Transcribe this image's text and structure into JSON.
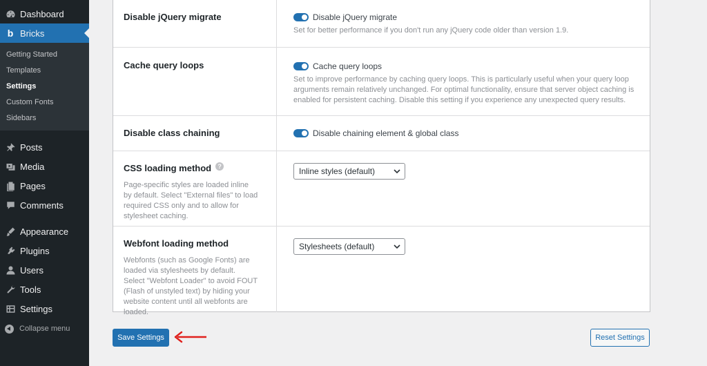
{
  "sidebar": {
    "top_items": [
      {
        "label": "Dashboard",
        "icon": "dashboard-icon"
      },
      {
        "label": "Bricks",
        "icon": "bricks-icon"
      }
    ],
    "submenu": [
      "Getting Started",
      "Templates",
      "Settings",
      "Custom Fonts",
      "Sidebars"
    ],
    "items_group1": [
      {
        "label": "Posts",
        "icon": "pin-icon"
      },
      {
        "label": "Media",
        "icon": "media-icon"
      },
      {
        "label": "Pages",
        "icon": "pages-icon"
      },
      {
        "label": "Comments",
        "icon": "comments-icon"
      }
    ],
    "items_group2": [
      {
        "label": "Appearance",
        "icon": "appearance-icon"
      },
      {
        "label": "Plugins",
        "icon": "plugins-icon"
      },
      {
        "label": "Users",
        "icon": "users-icon"
      },
      {
        "label": "Tools",
        "icon": "tools-icon"
      },
      {
        "label": "Settings",
        "icon": "settings-icon"
      }
    ],
    "collapse_label": "Collapse menu"
  },
  "settings": {
    "jquery": {
      "title": "Disable jQuery migrate",
      "toggle_label": "Disable jQuery migrate",
      "desc": "Set for better performance if you don't run any jQuery code older than version 1.9."
    },
    "cache": {
      "title": "Cache query loops",
      "toggle_label": "Cache query loops",
      "desc": "Set to improve performance by caching query loops. This is particularly useful when your query loop arguments remain relatively unchanged. For optimal functionality, ensure that server object caching is enabled for persistent caching. Disable this setting if you experience any unexpected query results."
    },
    "chaining": {
      "title": "Disable class chaining",
      "toggle_label": "Disable chaining element & global class"
    },
    "css": {
      "title": "CSS loading method",
      "help": "?",
      "desc": "Page-specific styles are loaded inline by default. Select \"External files\" to load required CSS only and to allow for stylesheet caching.",
      "selected": "Inline styles (default)"
    },
    "webfont": {
      "title": "Webfont loading method",
      "desc": "Webfonts (such as Google Fonts) are loaded via stylesheets by default. Select \"Webfont Loader\" to avoid FOUT (Flash of unstyled text) by hiding your website content until all webfonts are loaded.",
      "selected": "Stylesheets (default)"
    }
  },
  "buttons": {
    "save": "Save Settings",
    "reset": "Reset Settings"
  },
  "colors": {
    "accent": "#2271b1",
    "sidebar_bg": "#1d2327",
    "annotation_arrow": "#e0201c"
  }
}
